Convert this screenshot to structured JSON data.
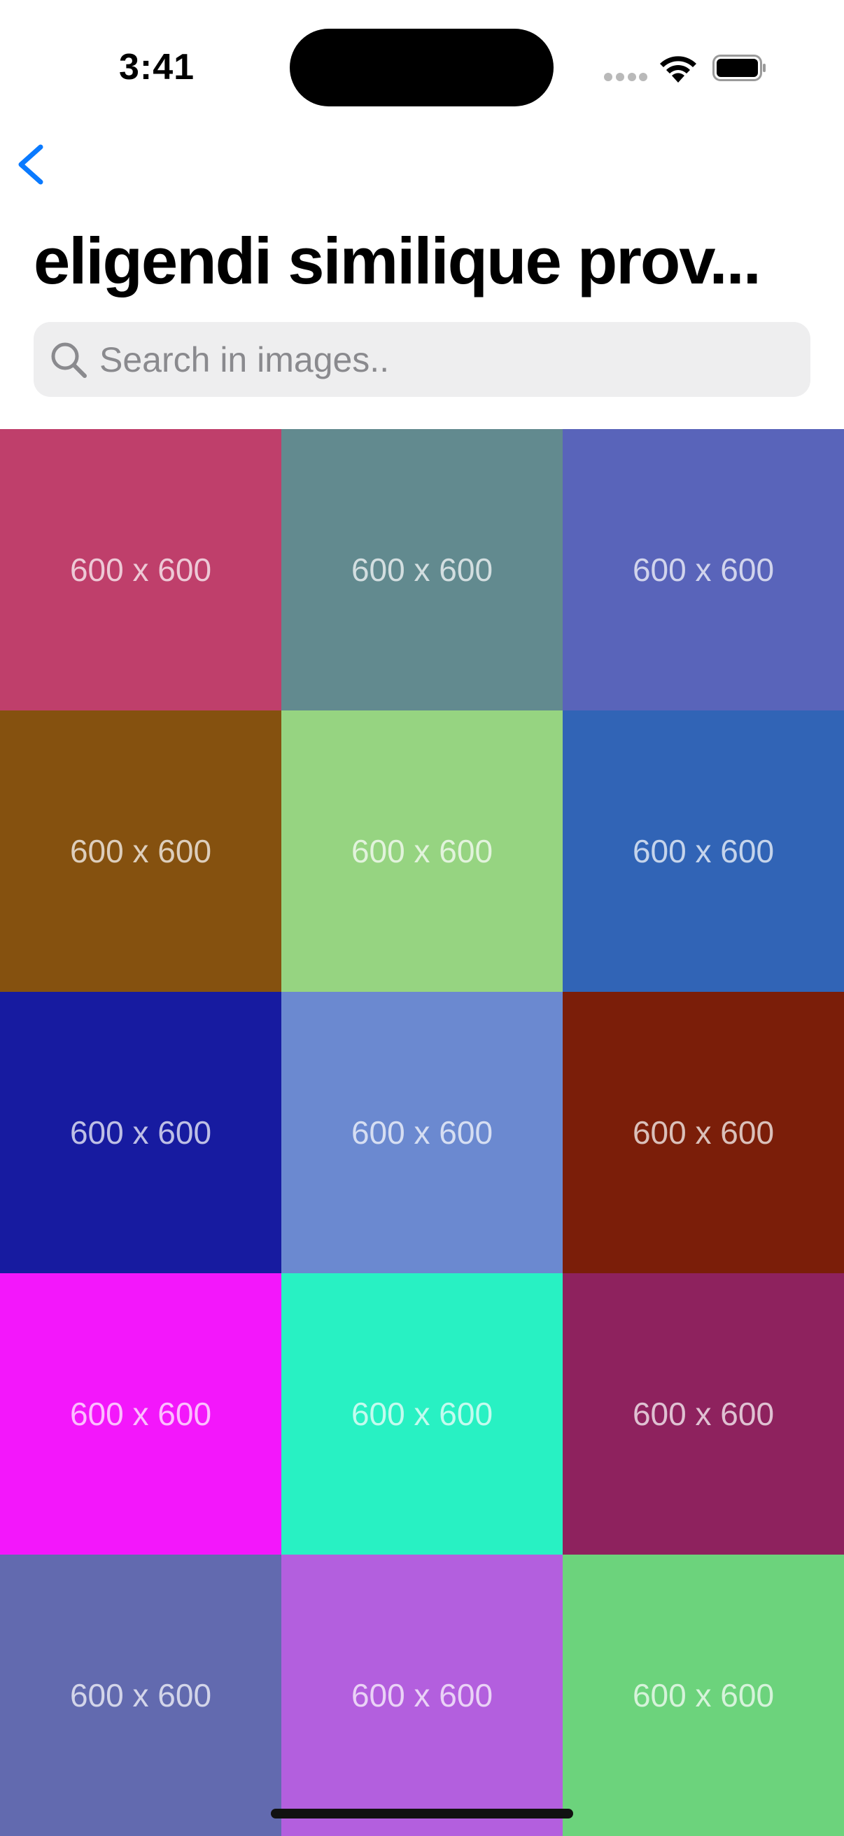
{
  "status_bar": {
    "time": "3:41",
    "icons": [
      "signal-dots-icon",
      "wifi-icon",
      "battery-icon"
    ]
  },
  "nav": {
    "back_icon": "chevron-left-icon",
    "accent_color": "#0a7aff"
  },
  "header": {
    "title": "eligendi similique prov..."
  },
  "search": {
    "placeholder": "Search in images..",
    "value": ""
  },
  "grid": {
    "tiles": [
      {
        "label": "600 x 600",
        "color": "#bf3f6b"
      },
      {
        "label": "600 x 600",
        "color": "#628a8f"
      },
      {
        "label": "600 x 600",
        "color": "#5964ba"
      },
      {
        "label": "600 x 600",
        "color": "#85510f"
      },
      {
        "label": "600 x 600",
        "color": "#96d481"
      },
      {
        "label": "600 x 600",
        "color": "#3164b6"
      },
      {
        "label": "600 x 600",
        "color": "#171ba0"
      },
      {
        "label": "600 x 600",
        "color": "#6b89d0"
      },
      {
        "label": "600 x 600",
        "color": "#7b1e09"
      },
      {
        "label": "600 x 600",
        "color": "#f317fb"
      },
      {
        "label": "600 x 600",
        "color": "#28f1c3"
      },
      {
        "label": "600 x 600",
        "color": "#8e225e"
      },
      {
        "label": "600 x 600",
        "color": "#626aaf"
      },
      {
        "label": "600 x 600",
        "color": "#b35fde"
      },
      {
        "label": "600 x 600",
        "color": "#6cd37c"
      }
    ]
  }
}
